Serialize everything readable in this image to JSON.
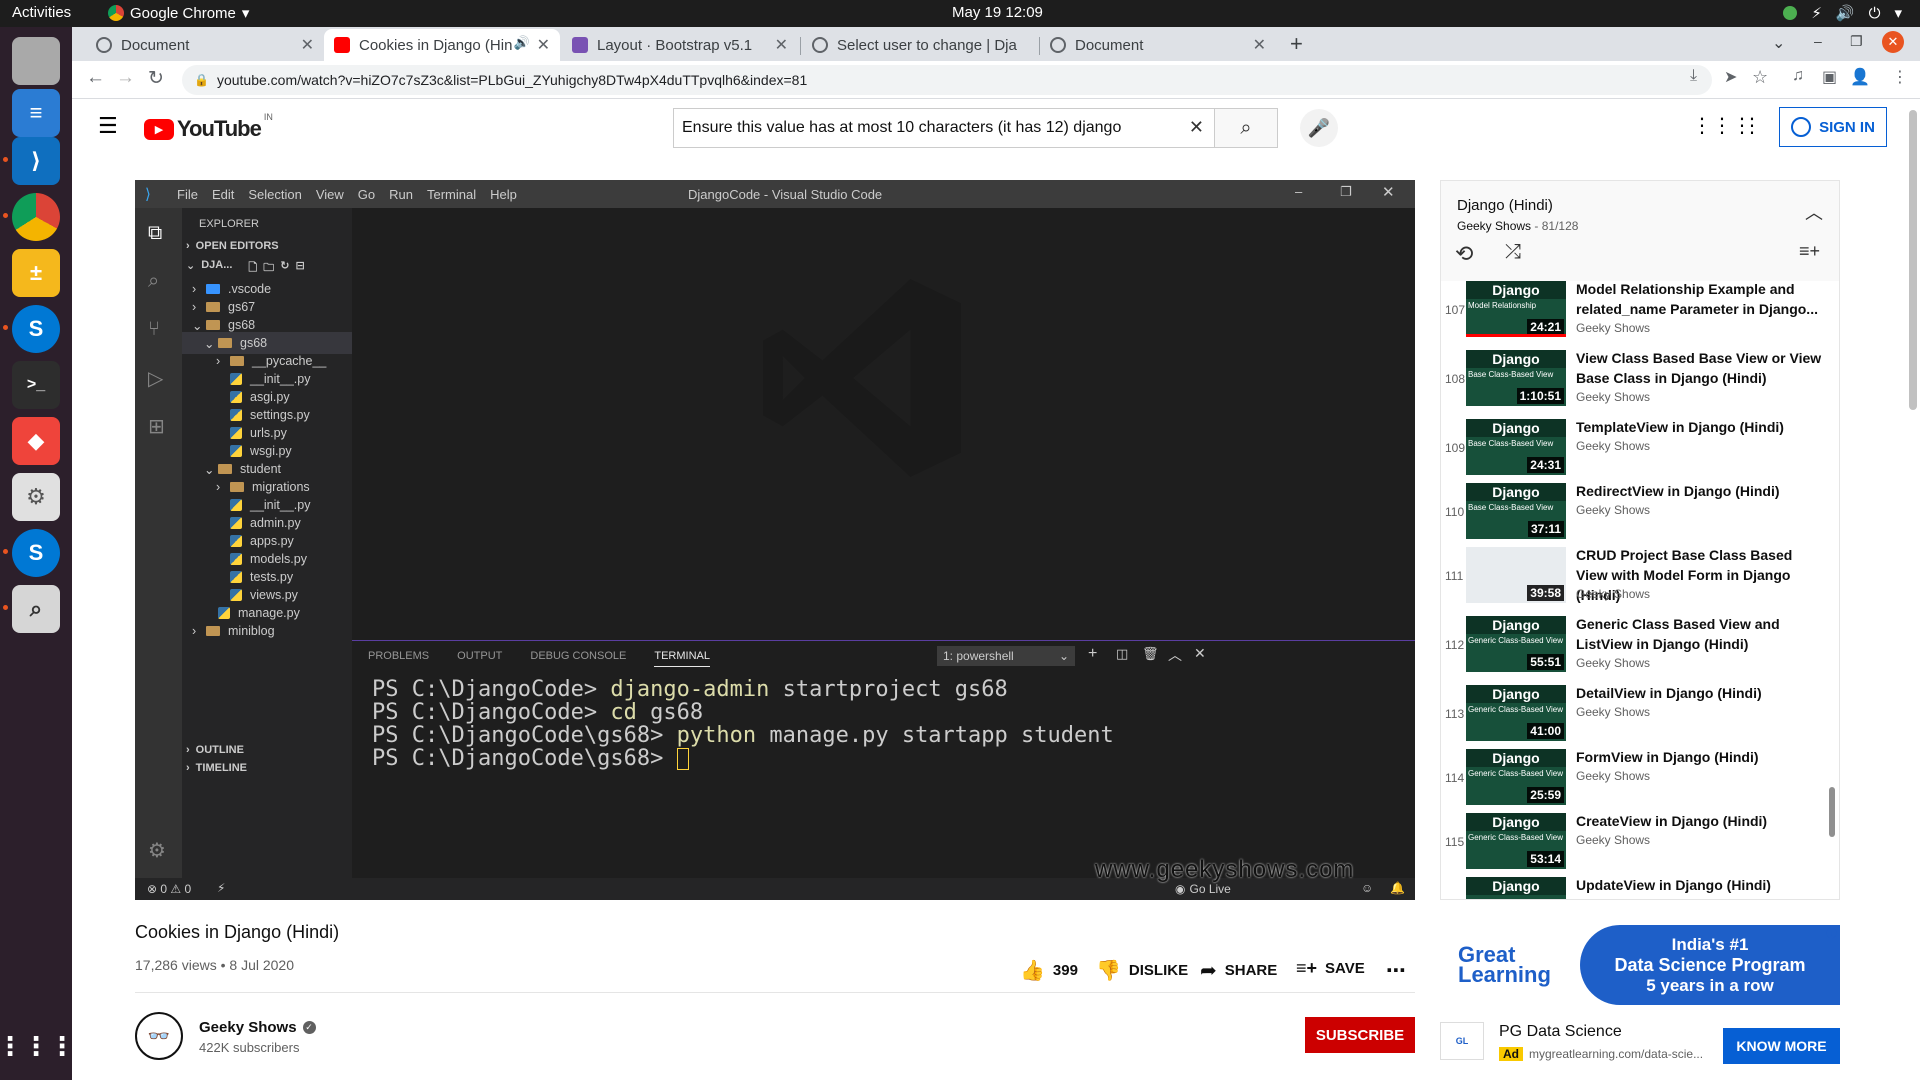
{
  "os": {
    "activities": "Activities",
    "app_name": "Google Chrome",
    "clock": "May 19  12:09"
  },
  "browser": {
    "tabs": [
      {
        "title": "Document",
        "active": false
      },
      {
        "title": "Cookies in Django (Hin",
        "active": true
      },
      {
        "title": "Layout · Bootstrap v5.1",
        "active": false
      },
      {
        "title": "Select user to change | Dja",
        "active": false
      },
      {
        "title": "Document",
        "active": false
      }
    ],
    "url": "youtube.com/watch?v=hiZO7c7sZ3c&list=PLbGui_ZYuhigchy8DTw4pX4duTTpvqlh6&index=81"
  },
  "youtube": {
    "logo_text": "YouTube",
    "region": "IN",
    "search_value": "Ensure this value has at most 10 characters (it has 12) django",
    "sign_in": "SIGN IN"
  },
  "vscode": {
    "menu": [
      "File",
      "Edit",
      "Selection",
      "View",
      "Go",
      "Run",
      "Terminal",
      "Help"
    ],
    "window_title": "DjangoCode - Visual Studio Code",
    "explorer_label": "EXPLORER",
    "open_editors": "OPEN EDITORS",
    "root": "DJA...",
    "tree": [
      {
        "name": ".vscode",
        "type": "folder",
        "depth": 0,
        "open": false
      },
      {
        "name": "gs67",
        "type": "folder",
        "depth": 0,
        "open": false
      },
      {
        "name": "gs68",
        "type": "folder",
        "depth": 0,
        "open": true
      },
      {
        "name": "gs68",
        "type": "folder",
        "depth": 1,
        "open": true
      },
      {
        "name": "__pycache__",
        "type": "folder",
        "depth": 2,
        "open": false
      },
      {
        "name": "__init__.py",
        "type": "py",
        "depth": 2
      },
      {
        "name": "asgi.py",
        "type": "py",
        "depth": 2
      },
      {
        "name": "settings.py",
        "type": "py",
        "depth": 2
      },
      {
        "name": "urls.py",
        "type": "py",
        "depth": 2
      },
      {
        "name": "wsgi.py",
        "type": "py",
        "depth": 2
      },
      {
        "name": "student",
        "type": "folder",
        "depth": 1,
        "open": true
      },
      {
        "name": "migrations",
        "type": "folder",
        "depth": 2,
        "open": false
      },
      {
        "name": "__init__.py",
        "type": "py",
        "depth": 2
      },
      {
        "name": "admin.py",
        "type": "py",
        "depth": 2
      },
      {
        "name": "apps.py",
        "type": "py",
        "depth": 2
      },
      {
        "name": "models.py",
        "type": "py",
        "depth": 2
      },
      {
        "name": "tests.py",
        "type": "py",
        "depth": 2
      },
      {
        "name": "views.py",
        "type": "py",
        "depth": 2
      },
      {
        "name": "manage.py",
        "type": "py",
        "depth": 1
      },
      {
        "name": "miniblog",
        "type": "folder",
        "depth": 0,
        "open": false
      }
    ],
    "outline": "OUTLINE",
    "timeline": "TIMELINE",
    "panel_tabs": [
      "PROBLEMS",
      "OUTPUT",
      "DEBUG CONSOLE",
      "TERMINAL"
    ],
    "terminal_select": "1: powershell",
    "terminal_lines": [
      {
        "prompt": "PS C:\\DjangoCode> ",
        "cmd": "django-admin",
        "rest": " startproject gs68"
      },
      {
        "prompt": "PS C:\\DjangoCode> ",
        "cmd": "cd",
        "rest": " gs68"
      },
      {
        "prompt": "PS C:\\DjangoCode\\gs68> ",
        "cmd": "python",
        "rest": " manage.py startapp student"
      },
      {
        "prompt": "PS C:\\DjangoCode\\gs68> ",
        "cmd": "",
        "rest": ""
      }
    ],
    "status_left": "⊗ 0 ⚠ 0",
    "go_live": "Go Live",
    "watermark": "www.geekyshows.com"
  },
  "video": {
    "title": "Cookies in Django (Hindi)",
    "meta": "17,286 views • 8 Jul 2020",
    "likes": "399",
    "dislike": "DISLIKE",
    "share": "SHARE",
    "save": "SAVE",
    "channel": "Geeky Shows",
    "subscribers": "422K subscribers",
    "subscribe": "SUBSCRIBE"
  },
  "playlist": {
    "title": "Django (Hindi)",
    "owner": "Geeky Shows",
    "position": "81/128",
    "items": [
      {
        "index": "107",
        "title": "Model Relationship Example and related_name Parameter in Django...",
        "channel": "Geeky Shows",
        "duration": "24:21",
        "thumb_sub": "Model Relationship"
      },
      {
        "index": "108",
        "title": "View Class Based Base View or View Base Class in Django (Hindi)",
        "channel": "Geeky Shows",
        "duration": "1:10:51",
        "thumb_sub": "Base Class-Based View"
      },
      {
        "index": "109",
        "title": "TemplateView in Django (Hindi)",
        "channel": "Geeky Shows",
        "duration": "24:31",
        "thumb_sub": "Base Class-Based View"
      },
      {
        "index": "110",
        "title": "RedirectView in Django (Hindi)",
        "channel": "Geeky Shows",
        "duration": "37:11",
        "thumb_sub": "Base Class-Based View"
      },
      {
        "index": "111",
        "title": "CRUD Project Base Class Based View with Model Form in Django (Hindi)",
        "channel": "Geeky Shows",
        "duration": "39:58",
        "thumb_sub": ""
      },
      {
        "index": "112",
        "title": "Generic Class Based View and ListView in Django (Hindi)",
        "channel": "Geeky Shows",
        "duration": "55:51",
        "thumb_sub": "Generic Class-Based View"
      },
      {
        "index": "113",
        "title": "DetailView in Django (Hindi)",
        "channel": "Geeky Shows",
        "duration": "41:00",
        "thumb_sub": "Generic Class-Based View"
      },
      {
        "index": "114",
        "title": "FormView in Django (Hindi)",
        "channel": "Geeky Shows",
        "duration": "25:59",
        "thumb_sub": "Generic Class-Based View"
      },
      {
        "index": "115",
        "title": "CreateView in Django (Hindi)",
        "channel": "Geeky Shows",
        "duration": "53:14",
        "thumb_sub": "Generic Class-Based View"
      },
      {
        "index": "",
        "title": "UpdateView in Django (Hindi)",
        "channel": "",
        "duration": "",
        "thumb_sub": ""
      }
    ]
  },
  "ad": {
    "brand": "Great Learning",
    "banner_line1": "India's #1",
    "banner_line2": "Data Science Program",
    "banner_line3": "5 years in a row",
    "headline": "PG Data Science",
    "badge": "Ad",
    "url": "mygreatlearning.com/data-scie...",
    "cta": "KNOW MORE"
  },
  "colors": {
    "youtube_red": "#ff0000",
    "subscribe_red": "#cc0000",
    "link_blue": "#065fd4",
    "vscode_bg": "#1e1e1e"
  }
}
